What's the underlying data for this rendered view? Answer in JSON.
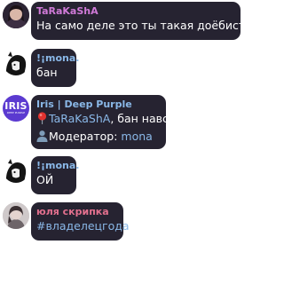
{
  "messages": [
    {
      "author": "TaRaKaShA",
      "author_color": "#d07ad8",
      "text": "На само деле это ты такая доёбистая"
    },
    {
      "author": "!¡mona.",
      "author_color": "#8ab8e8",
      "text": "бан"
    },
    {
      "author": "Iris | Deep Purple",
      "author_color": "#8ab8e8",
      "avatar_logo": "IRIS",
      "avatar_sub": "DEEP PURPLE",
      "line1_icon": "red-pin-icon",
      "line1_mention": "TaRaKaShA",
      "line1_text": ", бан навсегда",
      "line2_icon": "user-silhouette-icon",
      "line2_label": "Модератор: ",
      "line2_mention": "mona"
    },
    {
      "author": "!¡mona.",
      "author_color": "#8ab8e8",
      "text": "ОЙ"
    },
    {
      "author": "юля скрипка",
      "author_color": "#e2708e",
      "text": "#владелецгода"
    }
  ]
}
